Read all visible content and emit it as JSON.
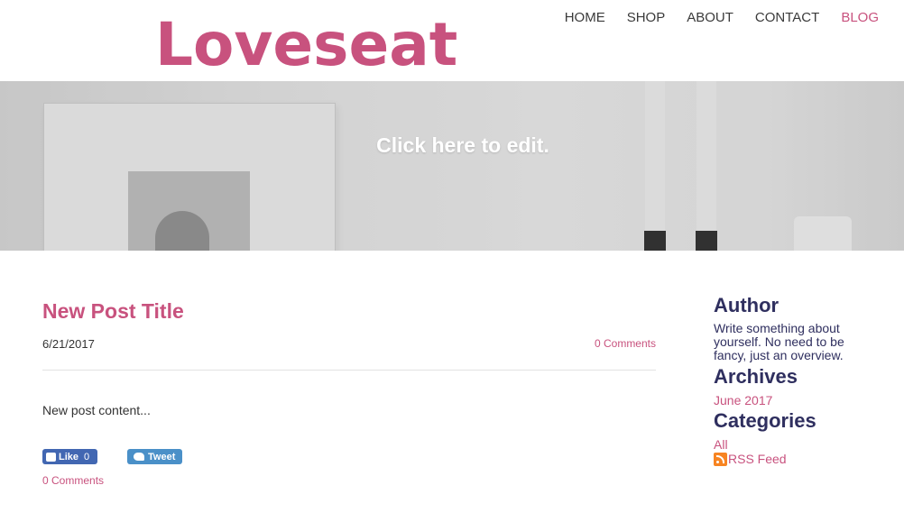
{
  "header": {
    "logo": "Loveseat",
    "nav": [
      {
        "label": "HOME"
      },
      {
        "label": "SHOP"
      },
      {
        "label": "ABOUT"
      },
      {
        "label": "CONTACT"
      },
      {
        "label": "BLOG",
        "active": true
      }
    ]
  },
  "banner": {
    "text": "Click here to edit."
  },
  "post": {
    "title": "New Post Title",
    "date": "6/21/2017",
    "comments_top": "0 Comments",
    "body": "New post content...",
    "like_label": "Like",
    "like_count": "0",
    "tweet_label": "Tweet",
    "comments_bottom": "0 Comments"
  },
  "sidebar": {
    "author_heading": "Author",
    "author_text": "Write something about yourself. No need to be fancy, just an overview.",
    "archives_heading": "Archives",
    "archives": [
      "June 2017"
    ],
    "categories_heading": "Categories",
    "categories": [
      "All"
    ],
    "rss_label": "RSS Feed"
  },
  "colors": {
    "accent": "#c8527e",
    "heading": "#2f2f5f",
    "facebook": "#4267b2",
    "twitter": "#4a90c8",
    "rss": "#f78422"
  }
}
